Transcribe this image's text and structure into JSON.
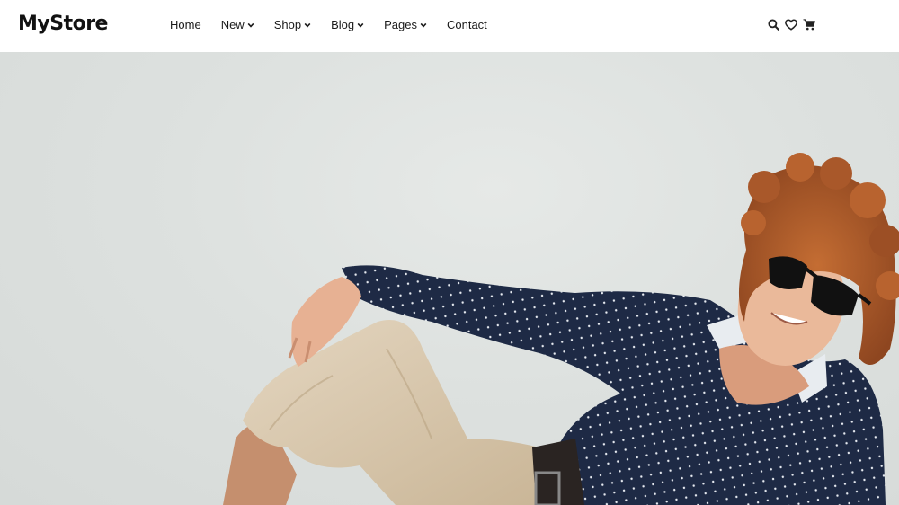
{
  "brand": {
    "logo_text": "MyStore"
  },
  "nav": {
    "items": [
      {
        "label": "Home",
        "has_dropdown": false
      },
      {
        "label": "New",
        "has_dropdown": true
      },
      {
        "label": "Shop",
        "has_dropdown": true
      },
      {
        "label": "Blog",
        "has_dropdown": true
      },
      {
        "label": "Pages",
        "has_dropdown": true
      },
      {
        "label": "Contact",
        "has_dropdown": false
      }
    ]
  },
  "header_icons": [
    "search-icon",
    "heart-icon",
    "cart-icon"
  ],
  "hero": {
    "image_subject": "man in polka-dot shirt and sunglasses reclining",
    "colors": {
      "background": "#dde1df",
      "shirt": "#1e2a45",
      "pants": "#d8c7ae",
      "hair": "#b5622e",
      "skin": "#e9b89a"
    }
  }
}
